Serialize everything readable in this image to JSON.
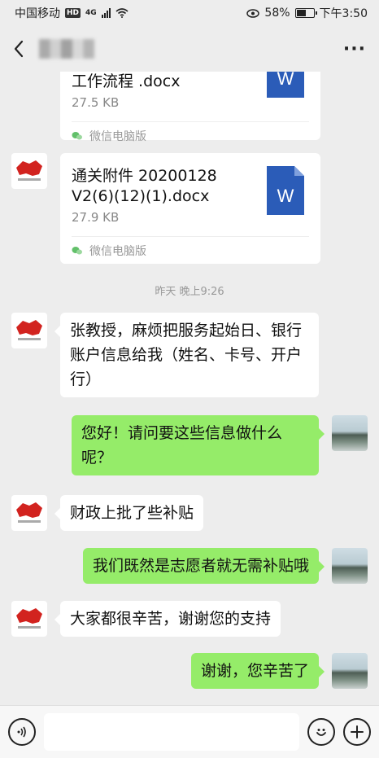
{
  "status_bar": {
    "carrier": "中国移动",
    "hd": "HD",
    "network": "4G",
    "battery_percent": "58%",
    "battery_level": 0.58,
    "time": "下午3:50"
  },
  "nav": {
    "back_icon": "chevron-left-icon",
    "more_label": "···"
  },
  "messages": {
    "file1": {
      "name": "工作流程 .docx",
      "size": "27.5 KB",
      "source": "微信电脑版",
      "icon_letter": "W"
    },
    "file2": {
      "name": "通关附件 20200128 V2(6)(12)(1).docx",
      "size": "27.9 KB",
      "source": "微信电脑版",
      "icon_letter": "W"
    },
    "timestamp": "昨天 晚上9:26",
    "msg1": "张教授，麻烦把服务起始日、银行账户信息给我（姓名、卡号、开户行）",
    "msg2": "您好！请问要这些信息做什么呢？",
    "msg3": "财政上批了些补贴",
    "msg4": "我们既然是志愿者就无需补贴哦",
    "msg5": "大家都很辛苦，谢谢您的支持",
    "msg6": "谢谢，您辛苦了"
  },
  "input_bar": {
    "voice_icon": "voice-icon",
    "emoji_icon": "emoji-icon",
    "plus_icon": "plus-icon"
  },
  "colors": {
    "background": "#ededed",
    "outgoing_bubble": "#95ec69",
    "incoming_bubble": "#ffffff",
    "word_blue": "#2b5cb8"
  }
}
